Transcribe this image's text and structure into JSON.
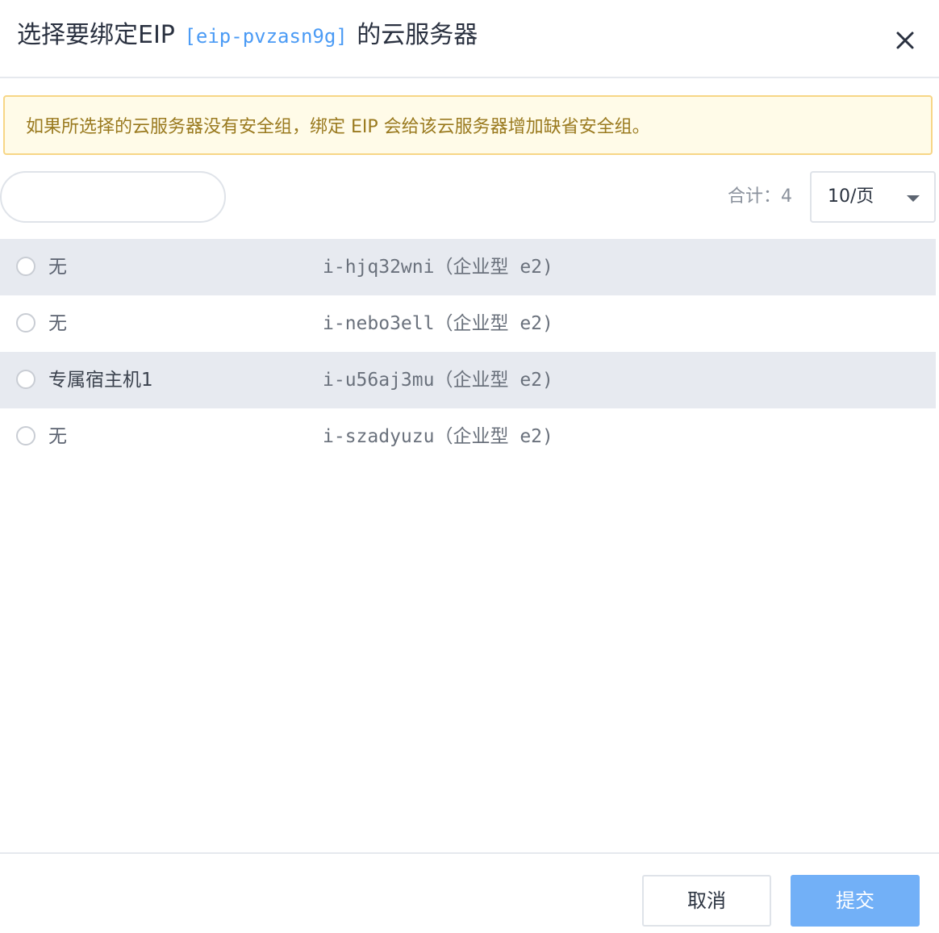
{
  "dialog": {
    "title_prefix": "选择要绑定EIP",
    "eip_id": "[eip-pvzasn9g]",
    "title_suffix": "的云服务器",
    "close_icon": "close-icon"
  },
  "alert": {
    "text": "如果所选择的云服务器没有安全组，绑定 EIP 会给该云服务器增加缺省安全组。"
  },
  "toolbar": {
    "search_value": "",
    "total_label": "合计：4",
    "page_size": "10/页"
  },
  "rows": [
    {
      "host": "无",
      "instance": "i-hjq32wni（企业型 e2)"
    },
    {
      "host": "无",
      "instance": "i-nebo3ell（企业型 e2)"
    },
    {
      "host": "专属宿主机1",
      "instance": "i-u56aj3mu（企业型 e2)"
    },
    {
      "host": "无",
      "instance": "i-szadyuzu（企业型 e2)"
    }
  ],
  "footer": {
    "cancel_label": "取消",
    "submit_label": "提交"
  },
  "colors": {
    "accent": "#4b9bf5",
    "submit_bg": "#72b0f7",
    "alert_bg": "#fffbe8",
    "alert_border": "#f7d686",
    "row_shade": "#e7eaf0"
  }
}
